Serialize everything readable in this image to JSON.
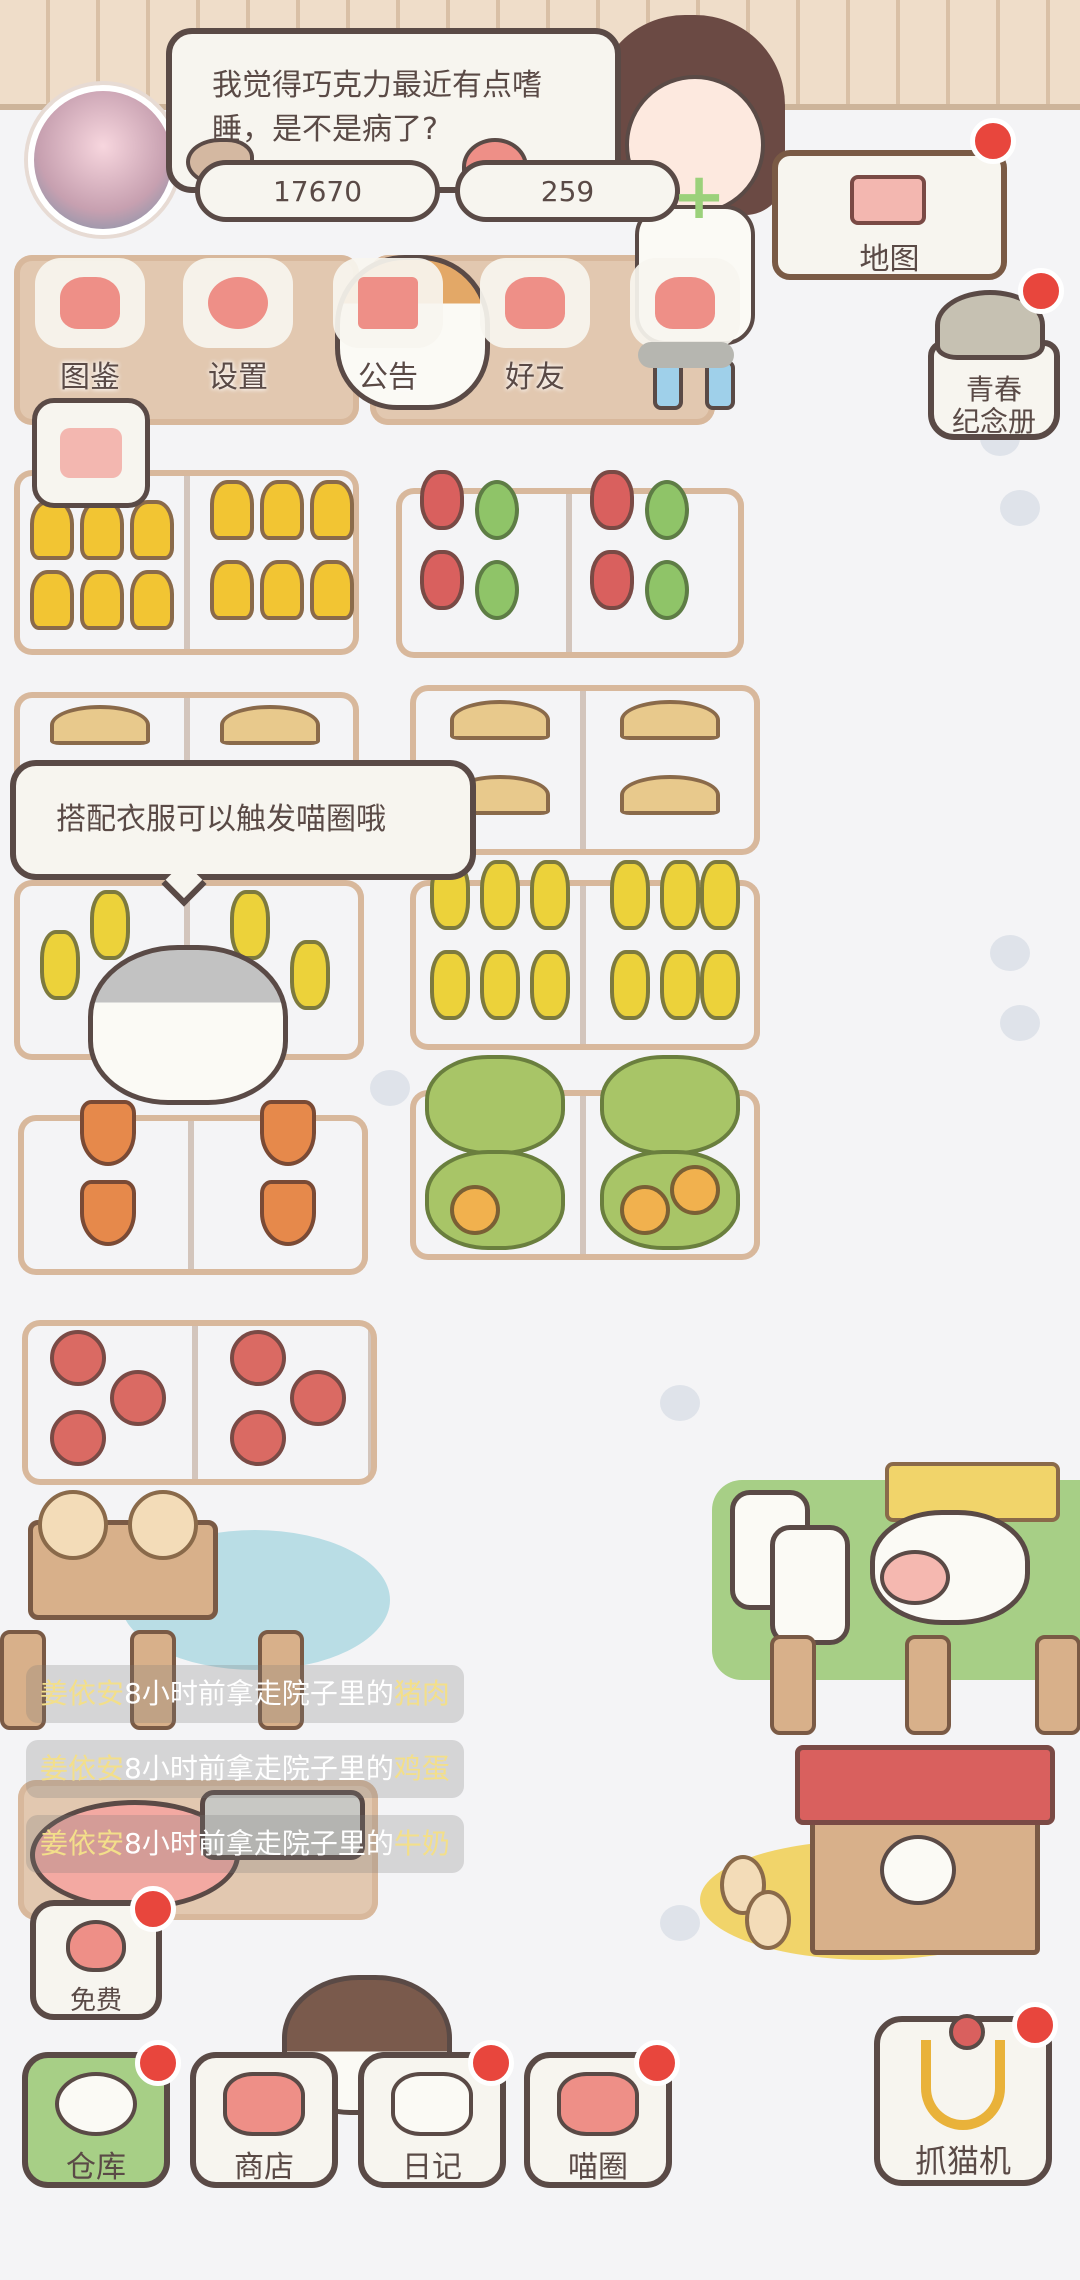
{
  "speech_top": {
    "line1": "我觉得巧克力最近有点嗜",
    "line2": "睡，是不是病了?"
  },
  "resources": {
    "fish": "17670",
    "hearts": "259",
    "plus_symbol": "+"
  },
  "top_menu": [
    {
      "label": "图鉴",
      "icon": "cat-face-icon"
    },
    {
      "label": "设置",
      "icon": "gear-icon"
    },
    {
      "label": "公告",
      "icon": "gift-icon"
    },
    {
      "label": "好友",
      "icon": "friends-icon"
    },
    {
      "label": "",
      "icon": "hearts-icon"
    }
  ],
  "map": {
    "label": "地图"
  },
  "memorial": {
    "label_line1": "青春",
    "label_line2": "纪念册"
  },
  "hint_bubble": "搭配衣服可以触发喵圈哦",
  "log_entries": [
    {
      "who": "姜依安",
      "mid": "8小时前拿走院子里的",
      "item": "猪肉"
    },
    {
      "who": "姜依安",
      "mid": "8小时前拿走院子里的",
      "item": "鸡蛋"
    },
    {
      "who": "姜依安",
      "mid": "8小时前拿走院子里的",
      "item": "牛奶"
    }
  ],
  "free": {
    "label": "免费"
  },
  "bottom_nav": [
    {
      "label": "仓库",
      "icon": "rice-bowl-icon",
      "active": true
    },
    {
      "label": "商店",
      "icon": "shop-icon",
      "active": false
    },
    {
      "label": "日记",
      "icon": "diary-icon",
      "active": false
    },
    {
      "label": "喵圈",
      "icon": "planet-cat-icon",
      "active": false
    }
  ],
  "claw_machine": {
    "label": "抓猫机",
    "icon": "claw-icon"
  },
  "colors": {
    "notify_dot": "#e8463d",
    "accent_pink": "#ee8f87",
    "outline": "#5a4a46",
    "active_green": "#a7cf86"
  }
}
